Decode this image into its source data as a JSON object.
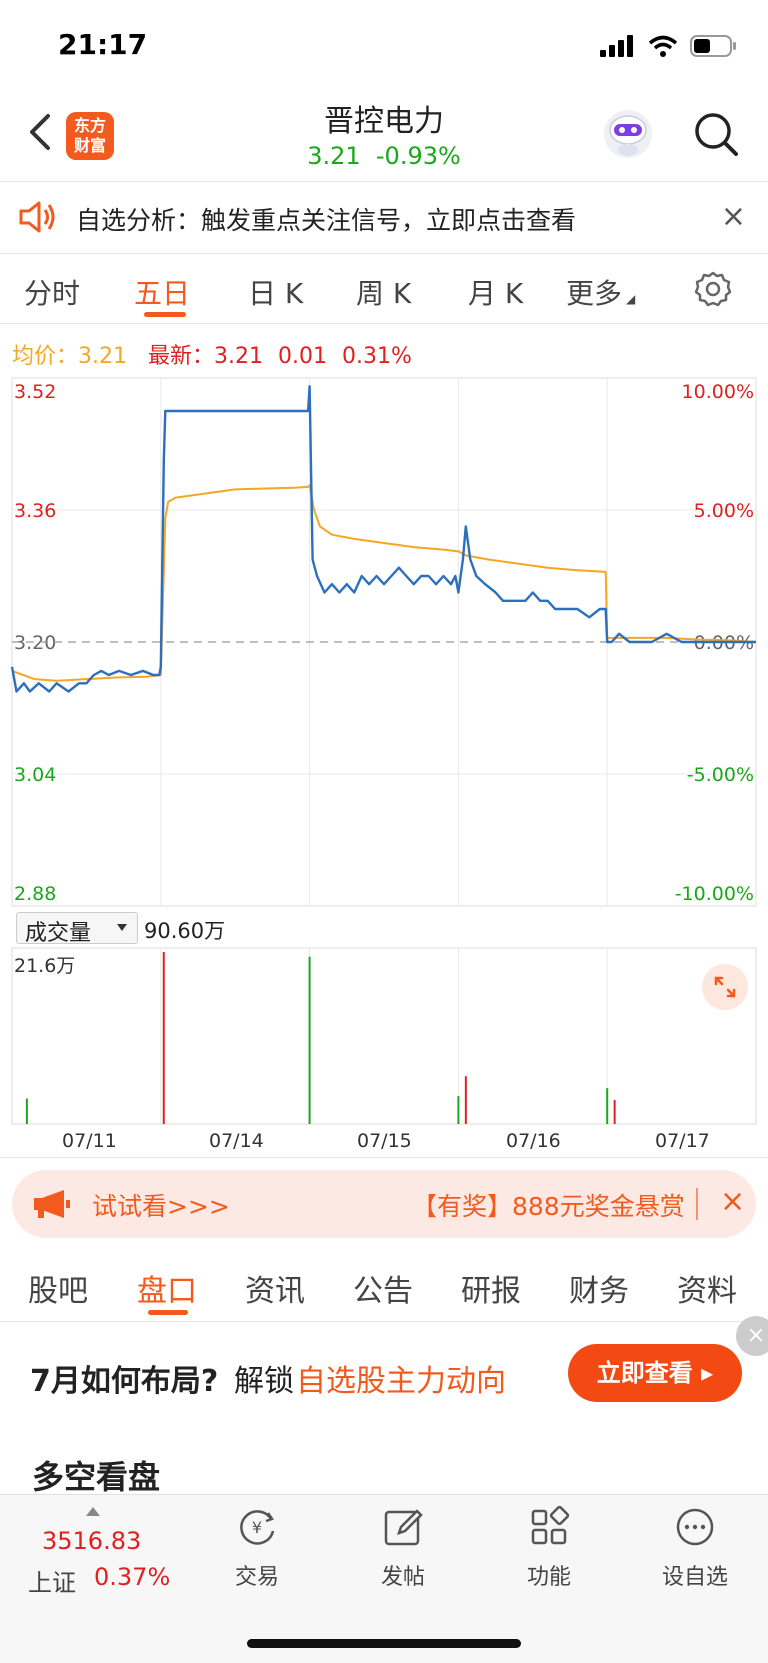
{
  "status": {
    "time": "21:17"
  },
  "header": {
    "logo_line1": "东方",
    "logo_line2": "财富",
    "stock_name": "晋控电力",
    "price": "3.21",
    "change_pct": "-0.93%"
  },
  "notice": {
    "text": "自选分析：触发重点关注信号，立即点击查看",
    "close": "×"
  },
  "chart_tabs": [
    "分时",
    "五日",
    "日 K",
    "周 K",
    "月 K",
    "更多"
  ],
  "active_chart_tab": 1,
  "summary": {
    "avg_label": "均价：",
    "avg_value": "3.21",
    "latest_label": "最新：",
    "latest_value": "3.21",
    "latest_change": "0.01",
    "latest_pct": "0.31%"
  },
  "volume": {
    "selector_label": "成交量",
    "current_value": "90.60万",
    "max_label": "21.6万"
  },
  "chart_data": [
    {
      "type": "line",
      "title": "",
      "x_ticks": [
        "07/11",
        "07/14",
        "07/15",
        "07/16",
        "07/17"
      ],
      "y_left_ticks": [
        "3.52",
        "3.36",
        "3.20",
        "3.04",
        "2.88"
      ],
      "y_right_ticks": [
        "10.00%",
        "5.00%",
        "0.00%",
        "-5.00%",
        "-10.00%"
      ],
      "ylim": [
        2.88,
        3.52
      ],
      "reference_price": 3.2,
      "days": 5,
      "series": [
        {
          "name": "price",
          "color": "#2b6fbd",
          "points": [
            [
              0,
              3.17
            ],
            [
              0.03,
              3.14
            ],
            [
              0.08,
              3.15
            ],
            [
              0.12,
              3.14
            ],
            [
              0.18,
              3.15
            ],
            [
              0.25,
              3.14
            ],
            [
              0.3,
              3.15
            ],
            [
              0.38,
              3.14
            ],
            [
              0.45,
              3.15
            ],
            [
              0.5,
              3.15
            ],
            [
              0.55,
              3.16
            ],
            [
              0.6,
              3.165
            ],
            [
              0.65,
              3.16
            ],
            [
              0.72,
              3.165
            ],
            [
              0.8,
              3.16
            ],
            [
              0.88,
              3.165
            ],
            [
              0.95,
              3.16
            ],
            [
              0.99,
              3.16
            ],
            [
              1.0,
              3.17
            ],
            [
              1.02,
              3.42
            ],
            [
              1.03,
              3.48
            ],
            [
              1.1,
              3.48
            ],
            [
              1.5,
              3.48
            ],
            [
              1.99,
              3.48
            ],
            [
              2.0,
              3.51
            ],
            [
              2.02,
              3.3
            ],
            [
              2.05,
              3.28
            ],
            [
              2.1,
              3.26
            ],
            [
              2.15,
              3.27
            ],
            [
              2.2,
              3.26
            ],
            [
              2.25,
              3.27
            ],
            [
              2.3,
              3.26
            ],
            [
              2.35,
              3.28
            ],
            [
              2.4,
              3.27
            ],
            [
              2.45,
              3.28
            ],
            [
              2.5,
              3.27
            ],
            [
              2.55,
              3.28
            ],
            [
              2.6,
              3.29
            ],
            [
              2.65,
              3.28
            ],
            [
              2.7,
              3.27
            ],
            [
              2.75,
              3.28
            ],
            [
              2.8,
              3.28
            ],
            [
              2.85,
              3.27
            ],
            [
              2.9,
              3.28
            ],
            [
              2.95,
              3.27
            ],
            [
              2.98,
              3.28
            ],
            [
              3.0,
              3.26
            ],
            [
              3.03,
              3.3
            ],
            [
              3.05,
              3.34
            ],
            [
              3.08,
              3.3
            ],
            [
              3.12,
              3.28
            ],
            [
              3.18,
              3.27
            ],
            [
              3.25,
              3.26
            ],
            [
              3.3,
              3.25
            ],
            [
              3.38,
              3.25
            ],
            [
              3.45,
              3.25
            ],
            [
              3.5,
              3.26
            ],
            [
              3.55,
              3.25
            ],
            [
              3.6,
              3.25
            ],
            [
              3.65,
              3.24
            ],
            [
              3.72,
              3.24
            ],
            [
              3.8,
              3.24
            ],
            [
              3.88,
              3.23
            ],
            [
              3.95,
              3.24
            ],
            [
              3.99,
              3.24
            ],
            [
              4.0,
              3.2
            ],
            [
              4.03,
              3.2
            ],
            [
              4.08,
              3.21
            ],
            [
              4.15,
              3.2
            ],
            [
              4.2,
              3.2
            ],
            [
              4.3,
              3.2
            ],
            [
              4.4,
              3.21
            ],
            [
              4.5,
              3.2
            ],
            [
              4.6,
              3.2
            ],
            [
              4.7,
              3.2
            ],
            [
              4.8,
              3.2
            ],
            [
              4.9,
              3.2
            ],
            [
              5.0,
              3.2
            ]
          ]
        },
        {
          "name": "avg",
          "color": "#f5a623",
          "points": [
            [
              0,
              3.165
            ],
            [
              0.15,
              3.155
            ],
            [
              0.3,
              3.153
            ],
            [
              0.5,
              3.155
            ],
            [
              0.7,
              3.157
            ],
            [
              0.9,
              3.158
            ],
            [
              1.0,
              3.16
            ],
            [
              1.03,
              3.35
            ],
            [
              1.05,
              3.37
            ],
            [
              1.1,
              3.375
            ],
            [
              1.3,
              3.38
            ],
            [
              1.5,
              3.385
            ],
            [
              1.7,
              3.386
            ],
            [
              1.9,
              3.387
            ],
            [
              1.99,
              3.388
            ],
            [
              2.0,
              3.39
            ],
            [
              2.03,
              3.36
            ],
            [
              2.07,
              3.34
            ],
            [
              2.15,
              3.33
            ],
            [
              2.3,
              3.325
            ],
            [
              2.5,
              3.32
            ],
            [
              2.7,
              3.315
            ],
            [
              2.9,
              3.312
            ],
            [
              2.99,
              3.31
            ],
            [
              3.0,
              3.31
            ],
            [
              3.05,
              3.305
            ],
            [
              3.2,
              3.3
            ],
            [
              3.4,
              3.295
            ],
            [
              3.6,
              3.29
            ],
            [
              3.8,
              3.287
            ],
            [
              3.99,
              3.285
            ],
            [
              4.0,
              3.205
            ],
            [
              4.2,
              3.205
            ],
            [
              4.4,
              3.205
            ],
            [
              4.6,
              3.203
            ],
            [
              4.8,
              3.202
            ],
            [
              5.0,
              3.2
            ]
          ]
        }
      ]
    },
    {
      "type": "bar",
      "title": "成交量",
      "ylim": [
        0,
        21.6
      ],
      "unit": "万",
      "peaks": [
        {
          "day": 0.1,
          "value": 3.2,
          "color": "green"
        },
        {
          "day": 1.02,
          "value": 21.6,
          "color": "red"
        },
        {
          "day": 2.0,
          "value": 21.0,
          "color": "green"
        },
        {
          "day": 3.05,
          "value": 6.0,
          "color": "red"
        },
        {
          "day": 3.0,
          "value": 3.5,
          "color": "green"
        },
        {
          "day": 4.0,
          "value": 4.5,
          "color": "green"
        },
        {
          "day": 4.05,
          "value": 3.0,
          "color": "red"
        }
      ]
    }
  ],
  "promo": {
    "left_text": "试试看>>>",
    "right_text": "【有奖】888元奖金悬赏",
    "close": "×"
  },
  "bottom_tabs": [
    "股吧",
    "盘口",
    "资讯",
    "公告",
    "研报",
    "财务",
    "资料"
  ],
  "active_bottom_tab": 1,
  "ad": {
    "title": "7月如何布局?",
    "unlock": "解锁",
    "highlight": "自选股主力动向",
    "button": "立即查看 ▸",
    "corner_close": "×"
  },
  "section_title": "多空看盘",
  "bottom_nav": {
    "index_value": "3516.83",
    "index_name": "上证",
    "index_pct": "0.37%",
    "items": [
      "交易",
      "发帖",
      "功能",
      "设自选"
    ]
  },
  "colors": {
    "accent": "#f25a1e",
    "up": "#e02020",
    "down": "#1aa81a",
    "price_line": "#2b6fbd",
    "avg_line": "#f5a623"
  }
}
